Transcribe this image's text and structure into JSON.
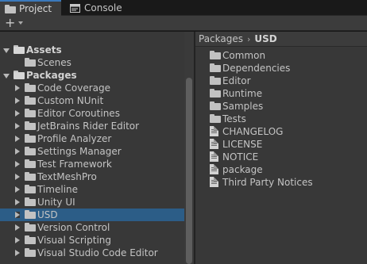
{
  "tabs": [
    {
      "label": "Project",
      "icon": "folder-icon",
      "active": true
    },
    {
      "label": "Console",
      "icon": "console-icon",
      "active": false
    }
  ],
  "toolbar": {
    "add_label": "+",
    "add_icon": "plus-icon"
  },
  "colors": {
    "selection": "#2c5d87",
    "panel": "#383838",
    "tab_active_accent": "#3a79bb"
  },
  "tree": [
    {
      "label": "Assets",
      "expanded": true,
      "bold": true,
      "depth": 0
    },
    {
      "label": "Scenes",
      "depth": 1,
      "leaf": true
    },
    {
      "label": "Packages",
      "expanded": true,
      "bold": true,
      "depth": 0
    },
    {
      "label": "Code Coverage",
      "depth": 1
    },
    {
      "label": "Custom NUnit",
      "depth": 1
    },
    {
      "label": "Editor Coroutines",
      "depth": 1
    },
    {
      "label": "JetBrains Rider Editor",
      "depth": 1
    },
    {
      "label": "Profile Analyzer",
      "depth": 1
    },
    {
      "label": "Settings Manager",
      "depth": 1
    },
    {
      "label": "Test Framework",
      "depth": 1
    },
    {
      "label": "TextMeshPro",
      "depth": 1
    },
    {
      "label": "Timeline",
      "depth": 1
    },
    {
      "label": "Unity UI",
      "depth": 1
    },
    {
      "label": "USD",
      "depth": 1,
      "selected": true
    },
    {
      "label": "Version Control",
      "depth": 1
    },
    {
      "label": "Visual Scripting",
      "depth": 1
    },
    {
      "label": "Visual Studio Code Editor",
      "depth": 1
    }
  ],
  "breadcrumb": {
    "parent": "Packages",
    "separator": "›",
    "current": "USD"
  },
  "contents": [
    {
      "label": "Common",
      "icon": "folder-icon"
    },
    {
      "label": "Dependencies",
      "icon": "folder-icon"
    },
    {
      "label": "Editor",
      "icon": "folder-icon"
    },
    {
      "label": "Runtime",
      "icon": "folder-icon"
    },
    {
      "label": "Samples",
      "icon": "folder-icon"
    },
    {
      "label": "Tests",
      "icon": "folder-icon"
    },
    {
      "label": "CHANGELOG",
      "icon": "document-icon"
    },
    {
      "label": "LICENSE",
      "icon": "document-icon"
    },
    {
      "label": "NOTICE",
      "icon": "document-icon"
    },
    {
      "label": "package",
      "icon": "document-icon"
    },
    {
      "label": "Third Party Notices",
      "icon": "document-icon"
    }
  ]
}
